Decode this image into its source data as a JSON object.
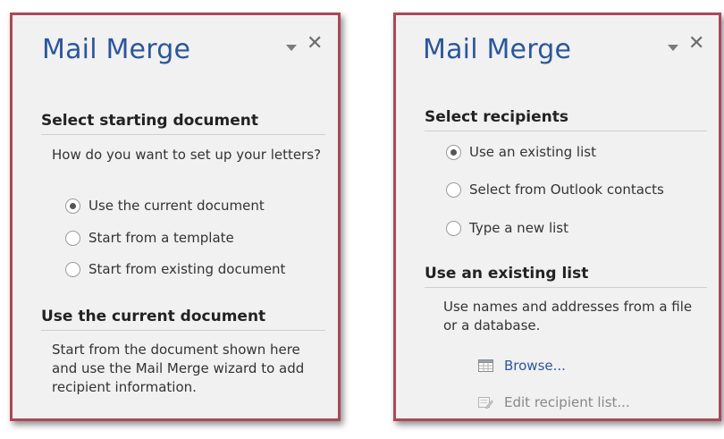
{
  "left_pane": {
    "title": "Mail Merge",
    "section1_heading": "Select starting document",
    "prompt": "How do you want to set up your letters?",
    "options": [
      {
        "label": "Use the current document",
        "checked": true
      },
      {
        "label": "Start from a template",
        "checked": false
      },
      {
        "label": "Start from existing document",
        "checked": false
      }
    ],
    "section2_heading": "Use the current document",
    "description": "Start from the document shown here and use the Mail Merge wizard to add recipient information."
  },
  "right_pane": {
    "title": "Mail Merge",
    "section1_heading": "Select recipients",
    "options": [
      {
        "label": "Use an existing list",
        "checked": true
      },
      {
        "label": "Select from Outlook contacts",
        "checked": false
      },
      {
        "label": "Type a new list",
        "checked": false
      }
    ],
    "section2_heading": "Use an existing list",
    "description": "Use names and addresses from a file or a database.",
    "browse_label": "Browse...",
    "edit_label": "Edit recipient list..."
  },
  "icons": {
    "dropdown": "chevron-down-icon",
    "close": "close-icon",
    "browse": "table-icon",
    "edit": "edit-list-icon"
  },
  "colors": {
    "title": "#2b579a",
    "frame": "#a9485a",
    "pane_bg": "#f1f1f1"
  }
}
